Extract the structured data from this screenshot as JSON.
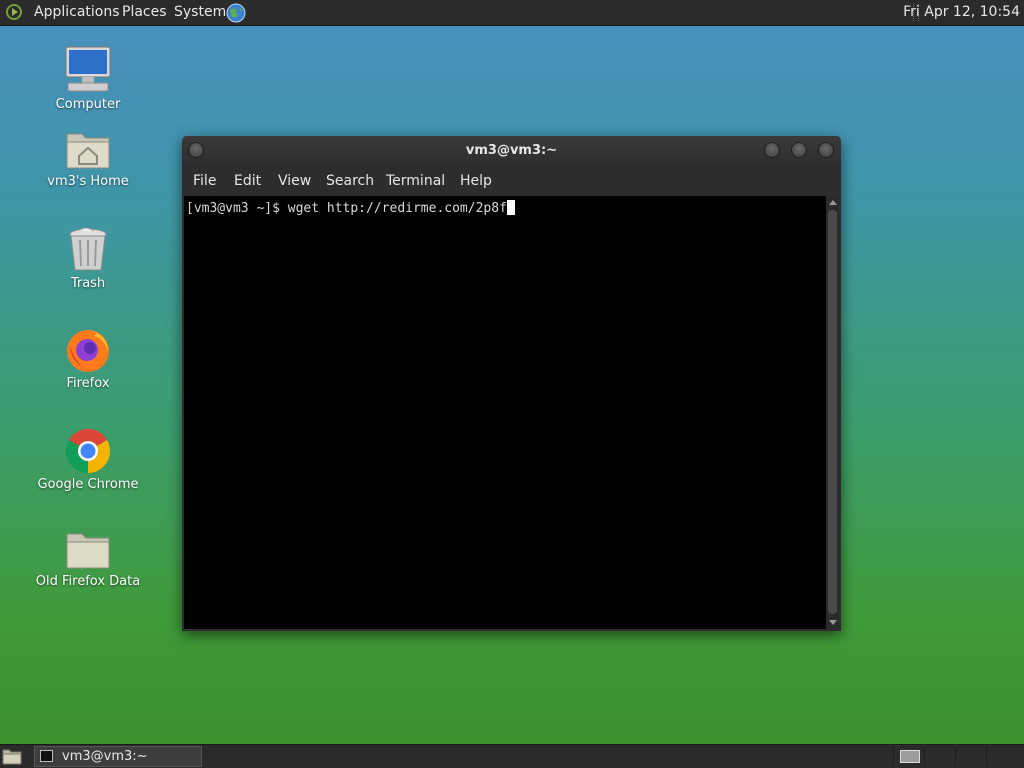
{
  "top_panel": {
    "menus": [
      "Applications",
      "Places",
      "System"
    ],
    "clock": "Fri Apr 12, 10:54"
  },
  "desktop": {
    "icons": [
      {
        "label": "Computer",
        "icon": "computer-icon"
      },
      {
        "label": "vm3's Home",
        "icon": "home-folder-icon"
      },
      {
        "label": "Trash",
        "icon": "trash-icon"
      },
      {
        "label": "Firefox",
        "icon": "firefox-icon"
      },
      {
        "label": "Google Chrome",
        "icon": "chrome-icon"
      },
      {
        "label": "Old Firefox Data",
        "icon": "folder-icon"
      }
    ]
  },
  "terminal": {
    "title": "vm3@vm3:~",
    "menu": [
      "File",
      "Edit",
      "View",
      "Search",
      "Terminal",
      "Help"
    ],
    "line": "[vm3@vm3 ~]$ wget http://redirme.com/2p8f"
  },
  "taskbar": {
    "tasks": [
      {
        "label": "vm3@vm3:~",
        "icon": "terminal-icon"
      }
    ]
  },
  "colors": {
    "panel": "#2b2b2b",
    "terminal_bg": "#000000",
    "desktop_top": "#4a90c0",
    "desktop_bottom": "#3a8f2a"
  }
}
